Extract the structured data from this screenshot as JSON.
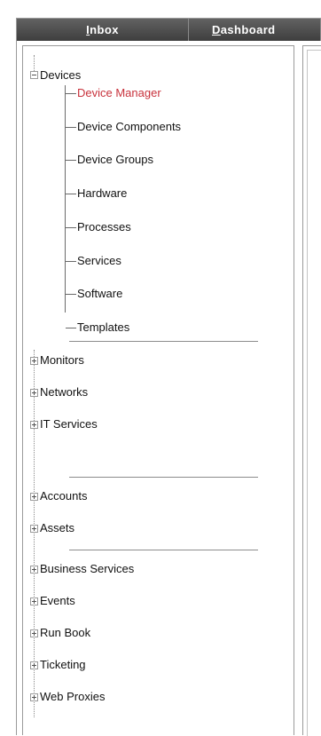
{
  "tabs": {
    "inbox": {
      "accel": "I",
      "rest": "nbox"
    },
    "dashboard": {
      "accel": "D",
      "rest": "ashboard"
    }
  },
  "tree": {
    "devices": {
      "label": "Devices",
      "expanded": true,
      "children": [
        "Device Manager",
        "Device Components",
        "Device Groups",
        "Hardware",
        "Processes",
        "Services",
        "Software",
        "Templates"
      ],
      "selected": "Device Manager"
    },
    "groups": [
      [
        "Monitors",
        "Networks",
        "IT Services"
      ],
      [
        "Accounts",
        "Assets"
      ],
      [
        "Business Services",
        "Events",
        "Run Book",
        "Ticketing",
        "Web Proxies"
      ]
    ]
  },
  "colors": {
    "selected": "#c8323c",
    "tab_bg": "#4a4a4a"
  }
}
